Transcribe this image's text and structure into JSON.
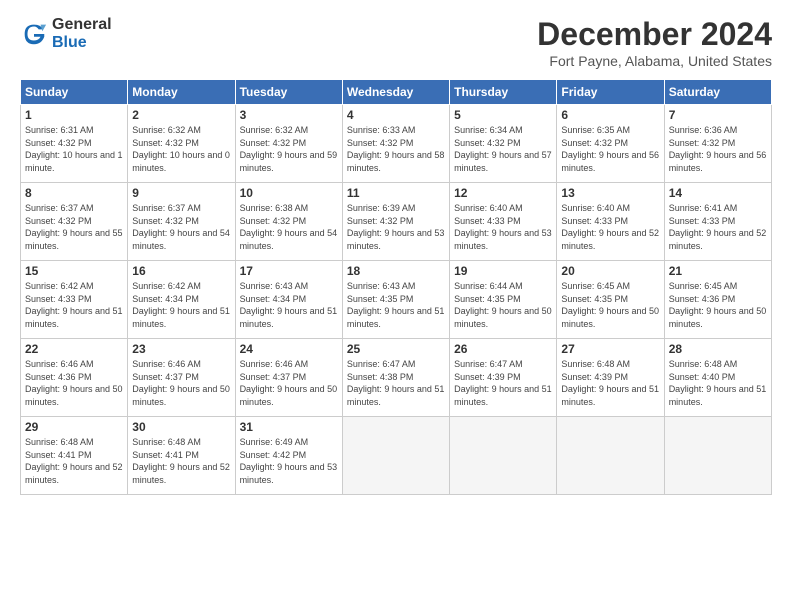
{
  "logo": {
    "general": "General",
    "blue": "Blue"
  },
  "title": "December 2024",
  "subtitle": "Fort Payne, Alabama, United States",
  "headers": [
    "Sunday",
    "Monday",
    "Tuesday",
    "Wednesday",
    "Thursday",
    "Friday",
    "Saturday"
  ],
  "days": [
    {
      "day": "",
      "empty": true
    },
    {
      "day": "",
      "empty": true
    },
    {
      "day": "",
      "empty": true
    },
    {
      "day": "",
      "empty": true
    },
    {
      "day": "",
      "empty": true
    },
    {
      "day": "",
      "empty": true
    },
    {
      "day": "1",
      "sunrise": "6:31 AM",
      "sunset": "4:32 PM",
      "daylight": "10 hours and 1 minute."
    },
    {
      "day": "2",
      "sunrise": "6:32 AM",
      "sunset": "4:32 PM",
      "daylight": "10 hours and 0 minutes."
    },
    {
      "day": "3",
      "sunrise": "6:32 AM",
      "sunset": "4:32 PM",
      "daylight": "9 hours and 59 minutes."
    },
    {
      "day": "4",
      "sunrise": "6:33 AM",
      "sunset": "4:32 PM",
      "daylight": "9 hours and 58 minutes."
    },
    {
      "day": "5",
      "sunrise": "6:34 AM",
      "sunset": "4:32 PM",
      "daylight": "9 hours and 57 minutes."
    },
    {
      "day": "6",
      "sunrise": "6:35 AM",
      "sunset": "4:32 PM",
      "daylight": "9 hours and 56 minutes."
    },
    {
      "day": "7",
      "sunrise": "6:36 AM",
      "sunset": "4:32 PM",
      "daylight": "9 hours and 56 minutes."
    },
    {
      "day": "8",
      "sunrise": "6:37 AM",
      "sunset": "4:32 PM",
      "daylight": "9 hours and 55 minutes."
    },
    {
      "day": "9",
      "sunrise": "6:37 AM",
      "sunset": "4:32 PM",
      "daylight": "9 hours and 54 minutes."
    },
    {
      "day": "10",
      "sunrise": "6:38 AM",
      "sunset": "4:32 PM",
      "daylight": "9 hours and 54 minutes."
    },
    {
      "day": "11",
      "sunrise": "6:39 AM",
      "sunset": "4:32 PM",
      "daylight": "9 hours and 53 minutes."
    },
    {
      "day": "12",
      "sunrise": "6:40 AM",
      "sunset": "4:33 PM",
      "daylight": "9 hours and 53 minutes."
    },
    {
      "day": "13",
      "sunrise": "6:40 AM",
      "sunset": "4:33 PM",
      "daylight": "9 hours and 52 minutes."
    },
    {
      "day": "14",
      "sunrise": "6:41 AM",
      "sunset": "4:33 PM",
      "daylight": "9 hours and 52 minutes."
    },
    {
      "day": "15",
      "sunrise": "6:42 AM",
      "sunset": "4:33 PM",
      "daylight": "9 hours and 51 minutes."
    },
    {
      "day": "16",
      "sunrise": "6:42 AM",
      "sunset": "4:34 PM",
      "daylight": "9 hours and 51 minutes."
    },
    {
      "day": "17",
      "sunrise": "6:43 AM",
      "sunset": "4:34 PM",
      "daylight": "9 hours and 51 minutes."
    },
    {
      "day": "18",
      "sunrise": "6:43 AM",
      "sunset": "4:35 PM",
      "daylight": "9 hours and 51 minutes."
    },
    {
      "day": "19",
      "sunrise": "6:44 AM",
      "sunset": "4:35 PM",
      "daylight": "9 hours and 50 minutes."
    },
    {
      "day": "20",
      "sunrise": "6:45 AM",
      "sunset": "4:35 PM",
      "daylight": "9 hours and 50 minutes."
    },
    {
      "day": "21",
      "sunrise": "6:45 AM",
      "sunset": "4:36 PM",
      "daylight": "9 hours and 50 minutes."
    },
    {
      "day": "22",
      "sunrise": "6:46 AM",
      "sunset": "4:36 PM",
      "daylight": "9 hours and 50 minutes."
    },
    {
      "day": "23",
      "sunrise": "6:46 AM",
      "sunset": "4:37 PM",
      "daylight": "9 hours and 50 minutes."
    },
    {
      "day": "24",
      "sunrise": "6:46 AM",
      "sunset": "4:37 PM",
      "daylight": "9 hours and 50 minutes."
    },
    {
      "day": "25",
      "sunrise": "6:47 AM",
      "sunset": "4:38 PM",
      "daylight": "9 hours and 51 minutes."
    },
    {
      "day": "26",
      "sunrise": "6:47 AM",
      "sunset": "4:39 PM",
      "daylight": "9 hours and 51 minutes."
    },
    {
      "day": "27",
      "sunrise": "6:48 AM",
      "sunset": "4:39 PM",
      "daylight": "9 hours and 51 minutes."
    },
    {
      "day": "28",
      "sunrise": "6:48 AM",
      "sunset": "4:40 PM",
      "daylight": "9 hours and 51 minutes."
    },
    {
      "day": "29",
      "sunrise": "6:48 AM",
      "sunset": "4:41 PM",
      "daylight": "9 hours and 52 minutes."
    },
    {
      "day": "30",
      "sunrise": "6:48 AM",
      "sunset": "4:41 PM",
      "daylight": "9 hours and 52 minutes."
    },
    {
      "day": "31",
      "sunrise": "6:49 AM",
      "sunset": "4:42 PM",
      "daylight": "9 hours and 53 minutes."
    },
    {
      "day": "",
      "empty": true
    },
    {
      "day": "",
      "empty": true
    },
    {
      "day": "",
      "empty": true
    },
    {
      "day": "",
      "empty": true
    }
  ],
  "labels": {
    "sunrise": "Sunrise:",
    "sunset": "Sunset:",
    "daylight": "Daylight:"
  }
}
